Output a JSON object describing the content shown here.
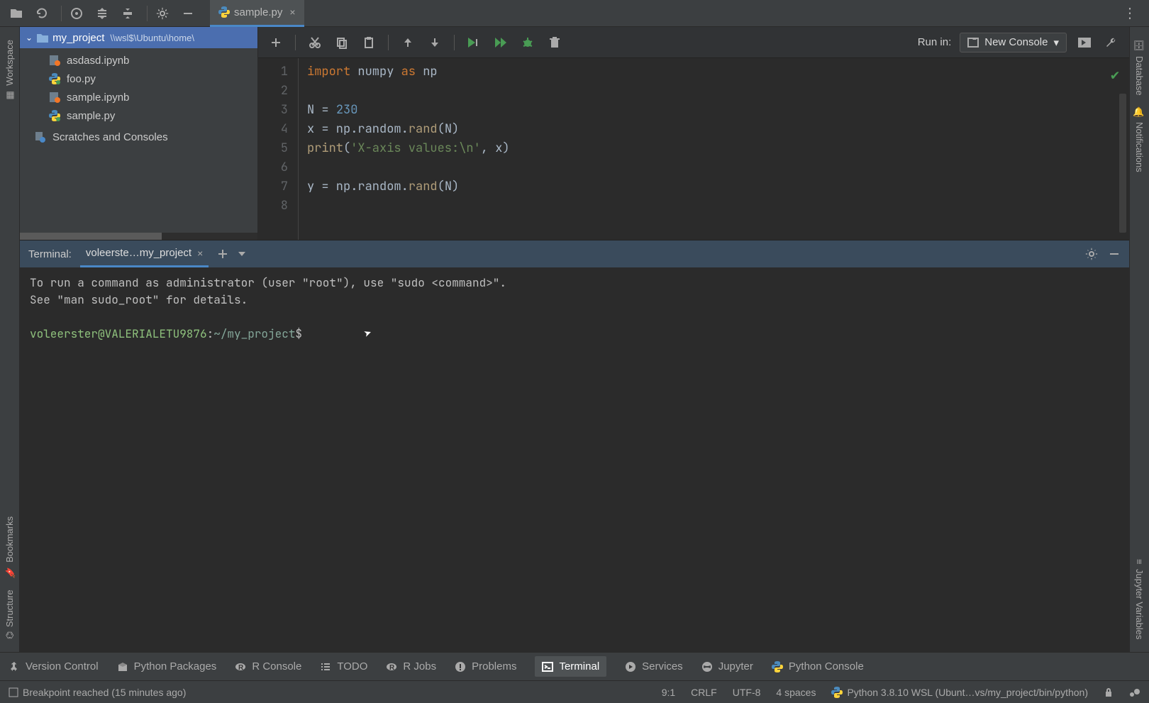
{
  "editor_tab": {
    "filename": "sample.py"
  },
  "project": {
    "name": "my_project",
    "path": "\\\\wsl$\\Ubuntu\\home\\",
    "files": [
      "asdasd.ipynb",
      "foo.py",
      "sample.ipynb",
      "sample.py"
    ],
    "scratches": "Scratches and Consoles"
  },
  "run": {
    "label": "Run in:",
    "selected": "New Console"
  },
  "code": {
    "lines": [
      {
        "n": "1",
        "segs": [
          {
            "t": "import ",
            "c": "kw"
          },
          {
            "t": "numpy ",
            "c": "id"
          },
          {
            "t": "as ",
            "c": "kw"
          },
          {
            "t": "np",
            "c": "id"
          }
        ]
      },
      {
        "n": "2",
        "segs": []
      },
      {
        "n": "3",
        "segs": [
          {
            "t": "N ",
            "c": "id"
          },
          {
            "t": "= ",
            "c": "id"
          },
          {
            "t": "230",
            "c": "num"
          }
        ]
      },
      {
        "n": "4",
        "segs": [
          {
            "t": "x ",
            "c": "id"
          },
          {
            "t": "= np.random.",
            "c": "id"
          },
          {
            "t": "rand",
            "c": "fn"
          },
          {
            "t": "(N)",
            "c": "id"
          }
        ]
      },
      {
        "n": "5",
        "segs": [
          {
            "t": "print",
            "c": "fn"
          },
          {
            "t": "(",
            "c": "id"
          },
          {
            "t": "'X-axis values:\\n'",
            "c": "str"
          },
          {
            "t": ", x)",
            "c": "id"
          }
        ]
      },
      {
        "n": "6",
        "segs": []
      },
      {
        "n": "7",
        "segs": [
          {
            "t": "y ",
            "c": "id"
          },
          {
            "t": "= np.random.",
            "c": "id"
          },
          {
            "t": "rand",
            "c": "fn"
          },
          {
            "t": "(N)",
            "c": "id"
          }
        ]
      },
      {
        "n": "8",
        "segs": []
      }
    ]
  },
  "terminal": {
    "title": "Terminal:",
    "tab": "voleerste…my_project",
    "line1": "To run a command as administrator (user \"root\"), use \"sudo <command>\".",
    "line2": "See \"man sudo_root\" for details.",
    "prompt_user": "voleerster@VALERIALETU9876",
    "prompt_sep": ":",
    "prompt_path": "~/my_project",
    "prompt_dollar": "$"
  },
  "bottom": {
    "items": [
      "Version Control",
      "Python Packages",
      "R Console",
      "TODO",
      "R Jobs",
      "Problems",
      "Terminal",
      "Services",
      "Jupyter",
      "Python Console"
    ]
  },
  "status": {
    "left": "Breakpoint reached (15 minutes ago)",
    "pos": "9:1",
    "eol": "CRLF",
    "enc": "UTF-8",
    "indent": "4 spaces",
    "interp": "Python 3.8.10 WSL (Ubunt…vs/my_project/bin/python)"
  },
  "left_rail": {
    "workspace": "Workspace",
    "bookmarks": "Bookmarks",
    "structure": "Structure"
  },
  "right_rail": {
    "database": "Database",
    "notifications": "Notifications",
    "jupyter": "Jupyter Variables"
  }
}
